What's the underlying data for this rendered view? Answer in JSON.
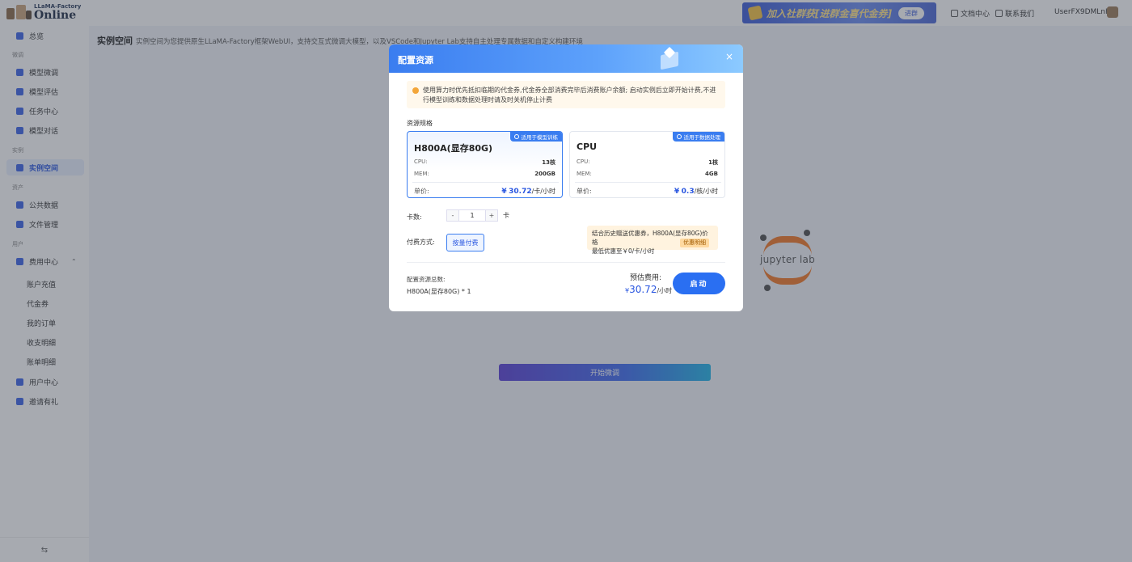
{
  "header": {
    "logo_small": "LLaMA-Factory",
    "logo_big": "Online",
    "banner_text": "加入社群获[进群金喜代金券]",
    "banner_button": "进群",
    "docs_label": "文档中心",
    "contact_label": "联系我们",
    "username": "UserFX9DMLnH"
  },
  "sidebar": {
    "home": "总览",
    "section_finetune": "微调",
    "finetune_items": [
      "模型微调",
      "模型评估",
      "任务中心",
      "模型对话"
    ],
    "section_instance": "实例",
    "instance_item": "实例空间",
    "section_assets": "资产",
    "asset_items": [
      "公共数据",
      "文件管理"
    ],
    "section_user": "用户",
    "billing": "费用中心",
    "billing_subitems": [
      "账户充值",
      "代金券",
      "我的订单",
      "收支明细",
      "账单明细"
    ],
    "user_center": "用户中心",
    "invite": "邀请有礼",
    "footer_icon": "collapse-icon",
    "footer_glyph": "⇆"
  },
  "main": {
    "title": "实例空间",
    "description": "实例空间为您提供原生LLaMA-Factory框架WebUI，支持交互式微调大模型，以及VSCode和Jupyter Lab支持自主处理专属数据和自定义构建环境",
    "jupyter_label": "jupyter lab",
    "start_button": "开始微调"
  },
  "modal": {
    "title": "配置资源",
    "close_glyph": "×",
    "notice": "使用算力时优先抵扣临期的代金券,代金券全部消费完毕后消费账户余额; 启动实例后立即开始计费,不进行模型训练和数据处理时请及时关机停止计费",
    "spec_label": "资源规格",
    "cards": [
      {
        "tag": "适用于模型训练",
        "name": "H800A(显存80G)",
        "cpu_label": "CPU:",
        "cpu_value": "13核",
        "mem_label": "MEM:",
        "mem_value": "200GB",
        "price_label": "单价:",
        "price_currency": "¥",
        "price_number": "30.72",
        "price_unit": "/卡/小时"
      },
      {
        "tag": "适用于数据处理",
        "name": "CPU",
        "cpu_label": "CPU:",
        "cpu_value": "1核",
        "mem_label": "MEM:",
        "mem_value": "4GB",
        "price_label": "单价:",
        "price_currency": "¥",
        "price_number": "0.3",
        "price_unit": "/核/小时"
      }
    ],
    "card_count_label": "卡数:",
    "stepper_minus": "-",
    "stepper_value": "1",
    "stepper_plus": "+",
    "stepper_unit": "卡",
    "pay_label": "付费方式:",
    "pay_option": "按量付费",
    "promo_line1": "结合历史赠送优惠券，H800A(显存80G)价格",
    "promo_line2": "最低优惠至￥0/卡/小时",
    "promo_button": "优惠明细",
    "summary_label": "配置资源总数:",
    "summary_value": "H800A(显存80G) * 1",
    "estimate_label": "预估费用:",
    "estimate_currency": "¥",
    "estimate_number": "30.72",
    "estimate_unit": "/小时",
    "launch_button": "启动"
  },
  "colors": {
    "accent": "#2a6ff2",
    "promo_bg": "#fff3df",
    "notice_bg": "#fff8ec",
    "jupyter_orange": "#f37726"
  }
}
